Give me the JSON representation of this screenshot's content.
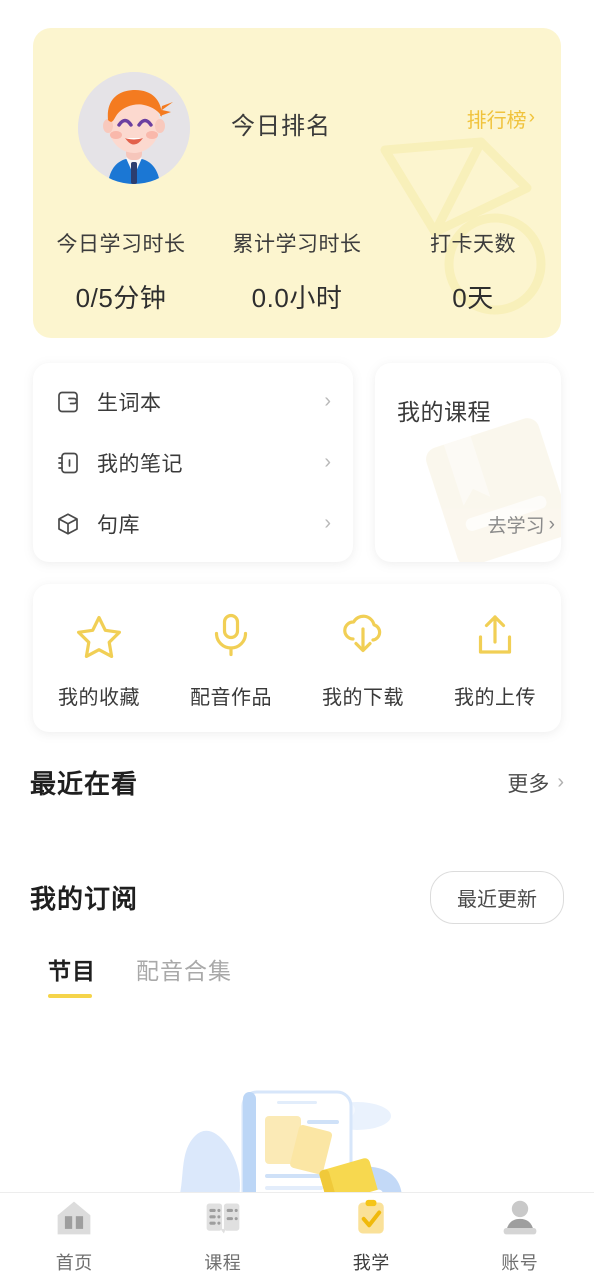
{
  "header": {
    "rank_title": "今日排名",
    "rank_link_label": "排行榜",
    "avatar_name": "user-avatar",
    "bg_color": "#fcf5cf",
    "accent_color": "#f0c33c",
    "stats": [
      {
        "label": "今日学习时长",
        "value": "0/5分钟"
      },
      {
        "label": "累计学习时长",
        "value": "0.0小时"
      },
      {
        "label": "打卡天数",
        "value": "0天"
      }
    ]
  },
  "menu_list": {
    "items": [
      {
        "icon": "wordbook-icon",
        "label": "生词本",
        "arrow": "›"
      },
      {
        "icon": "notebook-icon",
        "label": "我的笔记",
        "arrow": "›"
      },
      {
        "icon": "box-icon",
        "label": "句库",
        "arrow": "›"
      }
    ]
  },
  "course_card": {
    "title": "我的课程",
    "action_label": "去学习",
    "arrow": "›"
  },
  "quick_actions": {
    "items": [
      {
        "icon": "star-icon",
        "label": "我的收藏"
      },
      {
        "icon": "microphone-icon",
        "label": "配音作品"
      },
      {
        "icon": "cloud-download-icon",
        "label": "我的下载"
      },
      {
        "icon": "upload-icon",
        "label": "我的上传"
      }
    ],
    "icon_color": "#f3d25a"
  },
  "recent": {
    "title": "最近在看",
    "more_label": "更多",
    "arrow": "›"
  },
  "subscription": {
    "title": "我的订阅",
    "sort_button_label": "最近更新",
    "tabs": [
      {
        "label": "节目",
        "active": true
      },
      {
        "label": "配音合集",
        "active": false
      }
    ],
    "underline_color": "#f5d44a"
  },
  "tabbar": {
    "items": [
      {
        "icon": "home-book-icon",
        "label": "首页",
        "active": false
      },
      {
        "icon": "courses-icon",
        "label": "课程",
        "active": false
      },
      {
        "icon": "clipboard-check-icon",
        "label": "我学",
        "active": true
      },
      {
        "icon": "account-person-icon",
        "label": "账号",
        "active": false
      }
    ],
    "active_color": "#f5d44a",
    "inactive_color": "#d5d5d5"
  }
}
